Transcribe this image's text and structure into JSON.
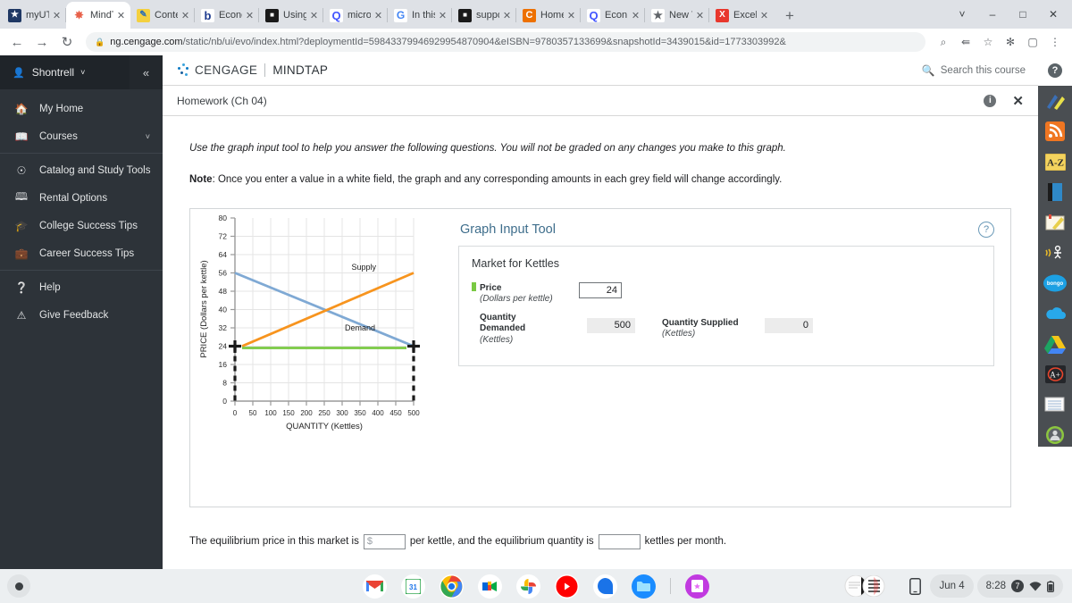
{
  "browser": {
    "tabs": [
      {
        "title": "myUT",
        "icon": "shield-icon",
        "icon_bg": "#1f3864",
        "icon_text": "⛨",
        "active": false
      },
      {
        "title": "MindT",
        "icon": "mindtap-icon",
        "icon_bg": "#ffffff",
        "icon_text": "✸",
        "active": true
      },
      {
        "title": "Conte",
        "icon": "note-edit-icon",
        "icon_bg": "#f4d03f",
        "icon_text": "✎",
        "active": false
      },
      {
        "title": "Econo",
        "icon": "bartleby-b-icon",
        "icon_bg": "#ffffff",
        "icon_text": "b",
        "active": false
      },
      {
        "title": "Using",
        "icon": "box-icon",
        "icon_bg": "#1a1a1a",
        "icon_text": "■",
        "active": false
      },
      {
        "title": "micro",
        "icon": "quizlet-q-icon",
        "icon_bg": "#ffffff",
        "icon_text": "Q",
        "active": false
      },
      {
        "title": "In this",
        "icon": "google-g-icon",
        "icon_bg": "#ffffff",
        "icon_text": "G",
        "active": false
      },
      {
        "title": "suppo",
        "icon": "box-icon",
        "icon_bg": "#1a1a1a",
        "icon_text": "■",
        "active": false
      },
      {
        "title": "Home",
        "icon": "chegg-c-icon",
        "icon_bg": "#ed7000",
        "icon_text": "C",
        "active": false
      },
      {
        "title": "Econ",
        "icon": "quizlet-q-icon",
        "icon_bg": "#ffffff",
        "icon_text": "Q",
        "active": false
      },
      {
        "title": "New T",
        "icon": "shield-icon",
        "icon_bg": "#ffffff",
        "icon_text": "⛨",
        "active": false
      },
      {
        "title": "Excel",
        "icon": "excel-x-icon",
        "icon_bg": "#e33",
        "icon_text": "X",
        "active": false
      }
    ],
    "new_tab_label": "+",
    "window_controls": [
      "˅",
      "–",
      "□",
      "✕"
    ],
    "back_label": "←",
    "forward_label": "→",
    "reload_label": "↻",
    "lock_label": "ὑ2",
    "url_domain": "ng.cengage.com",
    "url_path": "/static/nb/ui/evo/index.html?deploymentId=59843379946929954870904&eISBN=9780357133699&snapshotId=3439015&id=1773303992&",
    "omni_icons": [
      "zoom-out-icon",
      "share-icon",
      "bookmark-star-icon",
      "extensions-puzzle-icon",
      "side-panel-icon",
      "chrome-menu-icon"
    ]
  },
  "sidebar": {
    "user_name": "Shontrell",
    "user_chevron": "˅",
    "collapse_label": "«",
    "items": [
      {
        "label": "My Home",
        "icon": "home-icon",
        "glyph": "⌂",
        "chevron": ""
      },
      {
        "label": "Courses",
        "icon": "book-stack-icon",
        "glyph": "▤",
        "chevron": "˅"
      },
      {
        "label": "Catalog and Study Tools",
        "icon": "compass-icon",
        "glyph": "◎",
        "chevron": ""
      },
      {
        "label": "Rental Options",
        "icon": "open-book-icon",
        "glyph": "☷",
        "chevron": ""
      },
      {
        "label": "College Success Tips",
        "icon": "graduation-cap-icon",
        "glyph": "✒",
        "chevron": ""
      },
      {
        "label": "Career Success Tips",
        "icon": "briefcase-icon",
        "glyph": "▣",
        "chevron": ""
      },
      {
        "label": "Help",
        "icon": "question-circle-icon",
        "glyph": "?",
        "chevron": ""
      },
      {
        "label": "Give Feedback",
        "icon": "feedback-icon",
        "glyph": "!",
        "chevron": ""
      }
    ]
  },
  "header": {
    "brand_primary": "CENGAGE",
    "brand_secondary": "MINDTAP",
    "search_placeholder": "Search this course",
    "search_icon": "search-icon",
    "help_icon_label": "?"
  },
  "assignment": {
    "title": "Homework (Ch 04)",
    "info_icon_label": "i",
    "close_icon_label": "✕"
  },
  "question": {
    "instruction": "Use the graph input tool to help you answer the following questions. You will not be graded on any changes you make to this graph.",
    "note_label": "Note",
    "note_text": ": Once you enter a value in a white field, the graph and any corresponding amounts in each grey field will change accordingly.",
    "equilibrium_prefix": "The equilibrium price in this market is",
    "equilibrium_price_value": "$",
    "equilibrium_middle": "per kettle, and the equilibrium quantity is",
    "equilibrium_qty_value": "",
    "equilibrium_suffix": "kettles per month."
  },
  "graph_tool": {
    "title": "Graph Input Tool",
    "help_label": "?",
    "market_title": "Market for Kettles",
    "price_label": "Price",
    "price_units": "(Dollars per kettle)",
    "price_value": "24",
    "price_swatch_color": "#7ac943",
    "demand_label": "Quantity Demanded",
    "demand_label_l1": "Quantity",
    "demand_label_l2": "Demanded",
    "demand_units": "(Kettles)",
    "demand_value": "500",
    "supply_label": "Quantity Supplied",
    "supply_units": "(Kettles)",
    "supply_value": "0"
  },
  "chart_data": {
    "type": "line",
    "title": "",
    "xlabel": "QUANTITY (Kettles)",
    "ylabel": "PRICE (Dollars per kettle)",
    "xlim": [
      0,
      500
    ],
    "ylim": [
      0,
      80
    ],
    "xticks": [
      0,
      50,
      100,
      150,
      200,
      250,
      300,
      350,
      400,
      450,
      500
    ],
    "yticks": [
      0,
      8,
      16,
      24,
      32,
      40,
      48,
      56,
      64,
      72,
      80
    ],
    "grid": true,
    "legend_position": "inline-annotation",
    "series": [
      {
        "name": "Demand",
        "color": "#7fa9d4",
        "x": [
          0,
          500
        ],
        "y": [
          56,
          24
        ],
        "label_x": 320,
        "label_y": 31
      },
      {
        "name": "Supply",
        "color": "#f7941e",
        "x": [
          20,
          500
        ],
        "y": [
          24,
          56
        ],
        "label_x": 330,
        "label_y": 57
      },
      {
        "name": "Price line",
        "color": "#7ac943",
        "x": [
          20,
          480
        ],
        "y": [
          24,
          24
        ],
        "label_x": null,
        "label_y": null
      }
    ],
    "markers": [
      {
        "name": "quantity-demanded-marker",
        "x": 500,
        "y": 24,
        "style": "plus-black"
      },
      {
        "name": "quantity-supplied-marker",
        "x": 0,
        "y": 24,
        "style": "plus-black"
      }
    ],
    "dashed_verticals": [
      {
        "x": 0,
        "y_from": 0,
        "y_to": 24
      },
      {
        "x": 500,
        "y_from": 0,
        "y_to": 24
      }
    ]
  },
  "right_rail": {
    "items": [
      {
        "name": "highlighter-pen-icon",
        "glyph": "✏",
        "bg": "#4a4e52"
      },
      {
        "name": "rss-feed-icon",
        "glyph": "◠",
        "bg": "#ef7622"
      },
      {
        "name": "az-glossary-icon",
        "glyph": "A-Z",
        "bg": "#f2d05a"
      },
      {
        "name": "ebook-icon",
        "glyph": "▮",
        "bg": "#2f89c8"
      },
      {
        "name": "notes-icon",
        "glyph": "✎",
        "bg": "#f4efe0"
      },
      {
        "name": "read-speaker-icon",
        "glyph": "♪",
        "bg": "#4a4e52"
      },
      {
        "name": "bongo-icon",
        "glyph": "bongo",
        "bg": "#1ca0e3"
      },
      {
        "name": "onedrive-icon",
        "glyph": "☁",
        "bg": "#4a4e52"
      },
      {
        "name": "google-drive-icon",
        "glyph": "△",
        "bg": "#4a4e52"
      },
      {
        "name": "grade-a-plus-icon",
        "glyph": "A+",
        "bg": "#2a2d30"
      },
      {
        "name": "flashcards-icon",
        "glyph": "▤",
        "bg": "#f3f3f3"
      },
      {
        "name": "profile-avatar-icon",
        "glyph": "●",
        "bg": "#8cc63f"
      }
    ]
  },
  "shelf": {
    "launcher_name": "launcher-button",
    "apps": [
      {
        "name": "gmail-icon",
        "glyph": "M",
        "bg": "#ffffff",
        "color": "#ea4335"
      },
      {
        "name": "google-calendar-icon",
        "glyph": "31",
        "bg": "#ffffff",
        "color": "#1a73e8"
      },
      {
        "name": "chrome-icon",
        "glyph": "●",
        "bg": "#ffffff",
        "color": "#1a73e8"
      },
      {
        "name": "google-meet-icon",
        "glyph": "▶",
        "bg": "#ffffff",
        "color": "#00832d"
      },
      {
        "name": "google-photos-icon",
        "glyph": "✸",
        "bg": "#ffffff",
        "color": "#fbbc04"
      },
      {
        "name": "youtube-icon",
        "glyph": "▶",
        "bg": "#ff0000",
        "color": "#ffffff"
      },
      {
        "name": "google-messages-icon",
        "glyph": "●",
        "bg": "#ffffff",
        "color": "#1a73e8"
      },
      {
        "name": "files-icon",
        "glyph": "▰",
        "bg": "#1a8cff",
        "color": "#ffffff"
      },
      {
        "name": "canva-icon",
        "glyph": "✦",
        "bg": "#c13ae0",
        "color": "#ffffff"
      }
    ],
    "status": {
      "phone_hub_icon": "phone-icon",
      "date": "Jun 4",
      "time": "8:28",
      "notification_count": "7",
      "wifi_icon": "wifi-icon",
      "battery_icon": "battery-icon"
    }
  }
}
